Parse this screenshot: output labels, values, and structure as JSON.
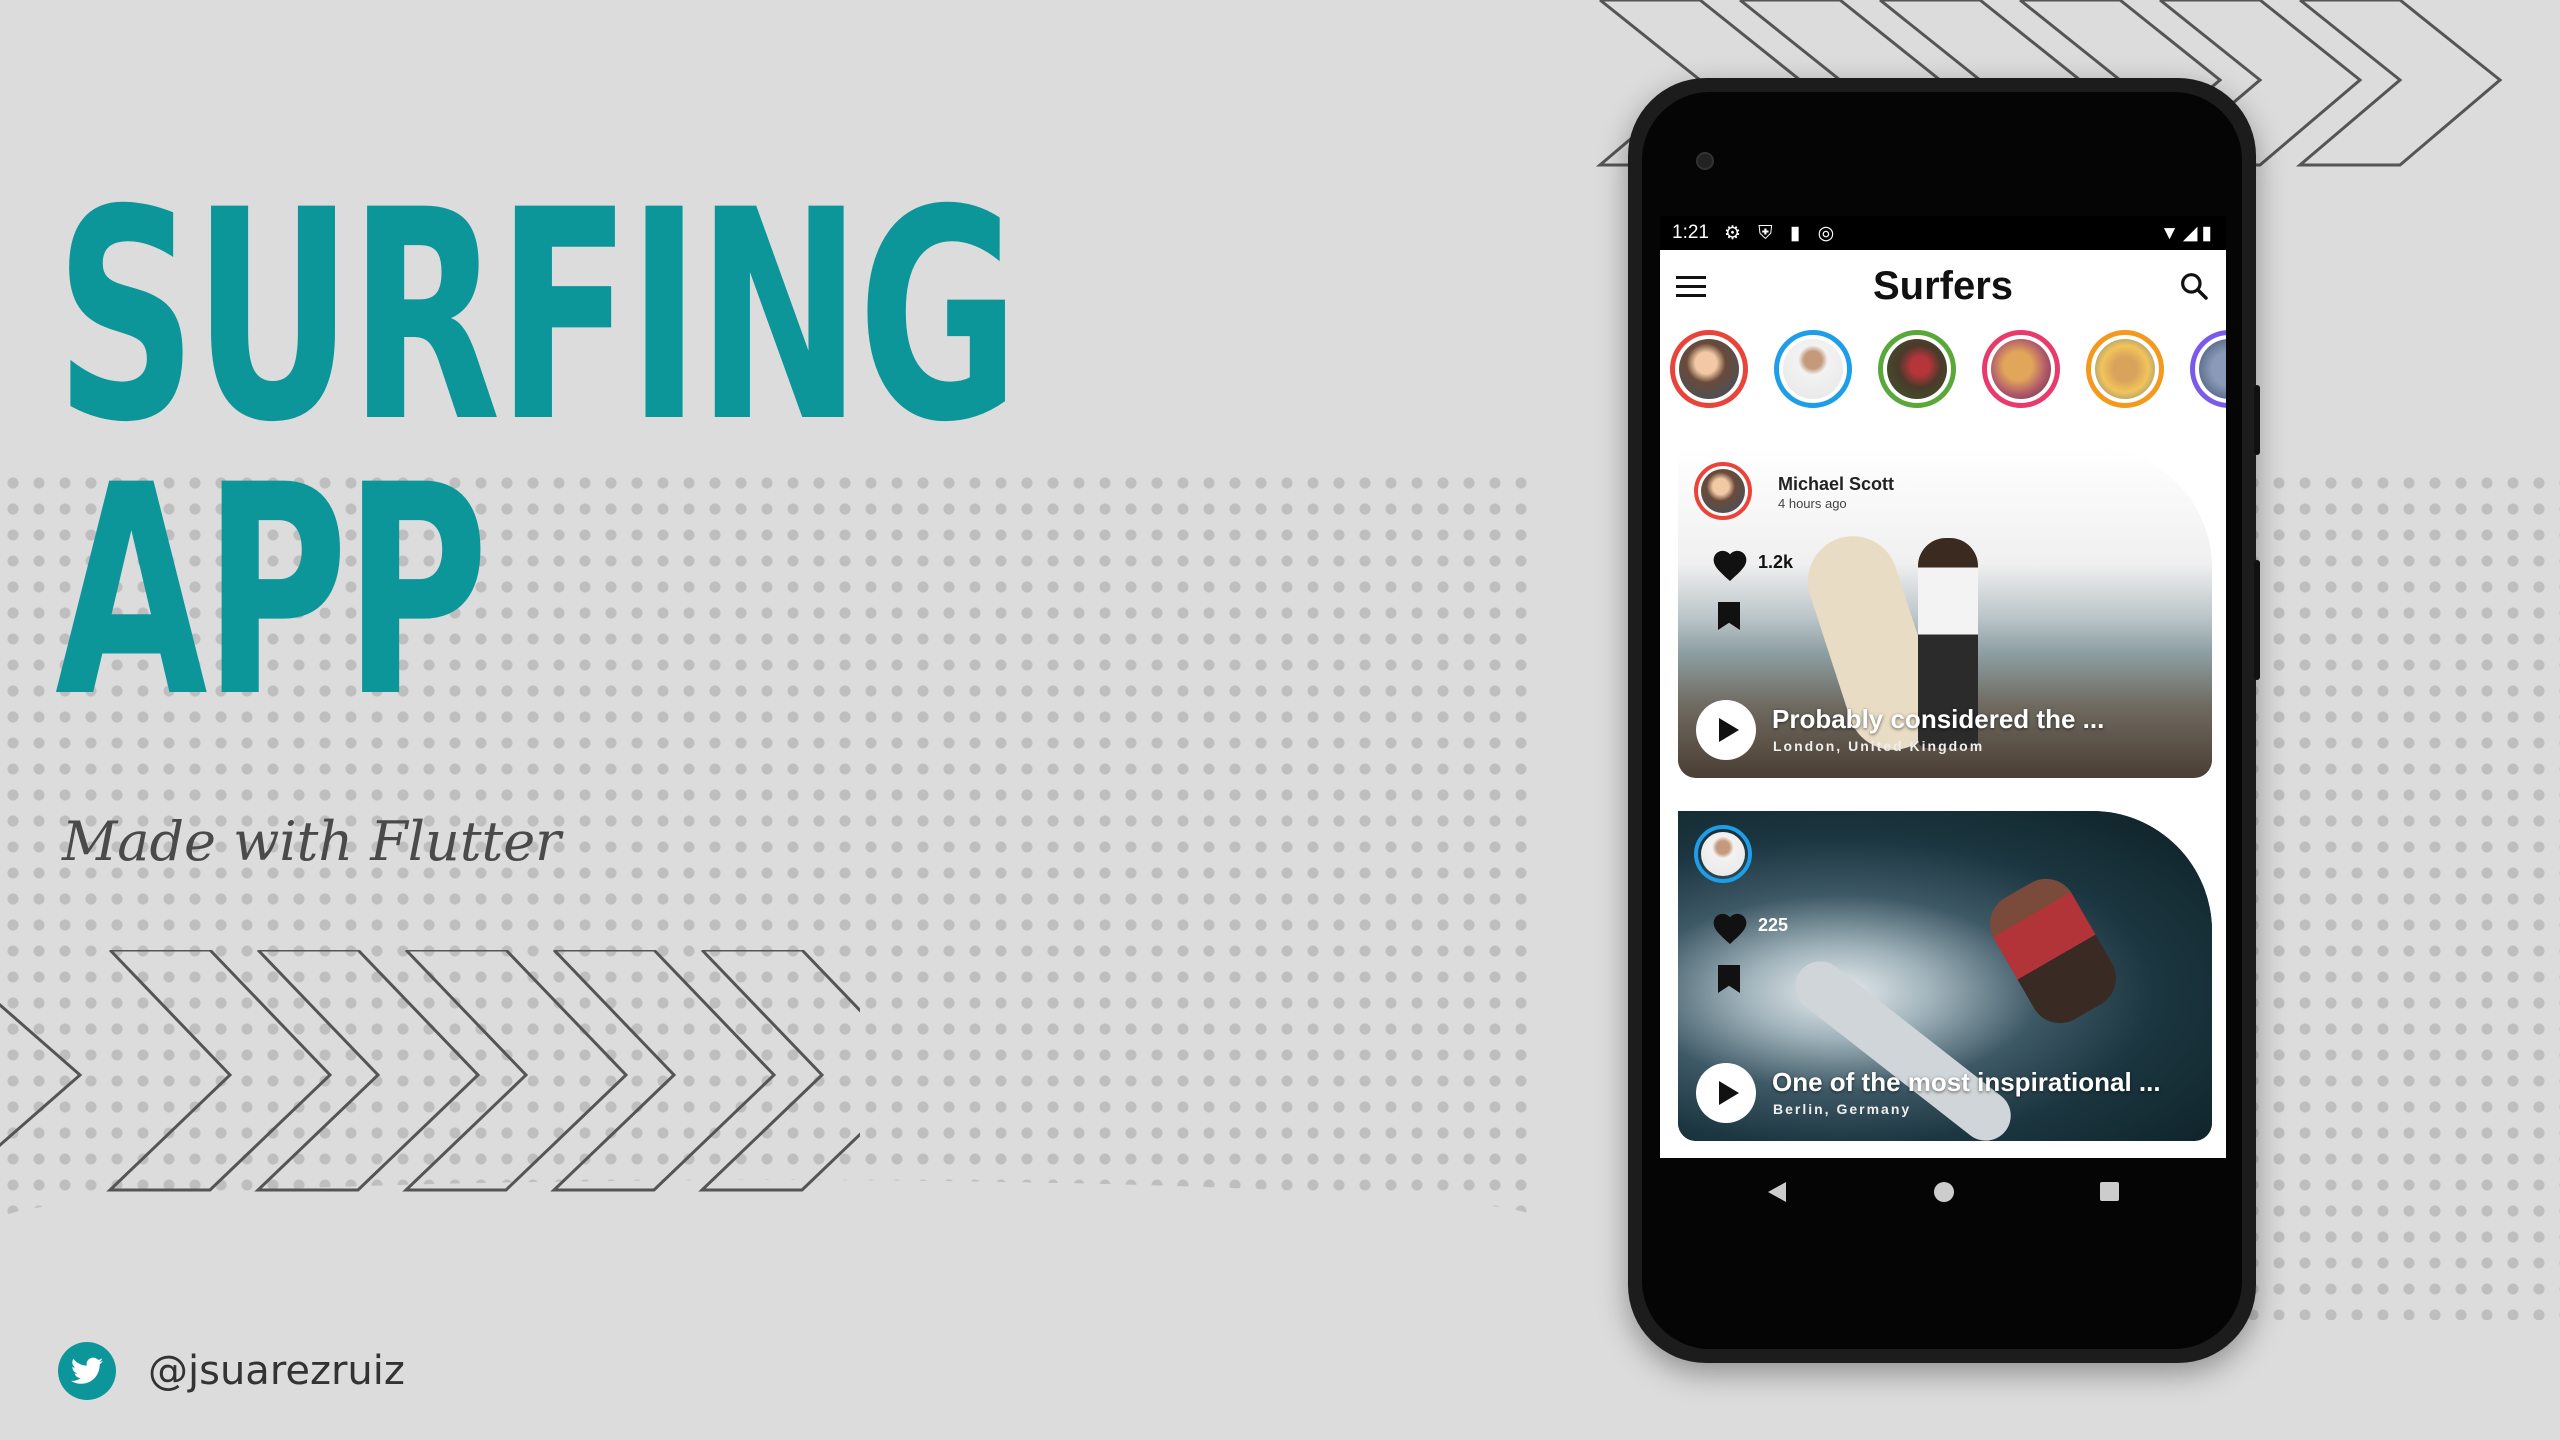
{
  "hero": {
    "line1": "SURFING",
    "line2": "APP",
    "tagline": "Made with Flutter",
    "handle": "@jsuarezruiz",
    "accent_color": "#0c969a"
  },
  "status_bar": {
    "time": "1:21",
    "left_icons": "⚙ ⛨ ▮ ◎",
    "right_icons": "▼◢▮"
  },
  "app": {
    "title": "Surfers"
  },
  "stories": [
    {
      "ring": "#e8443a",
      "icon": "avatar"
    },
    {
      "ring": "#1e9ee8",
      "icon": "avatar"
    },
    {
      "ring": "#5aa83a",
      "icon": "avatar"
    },
    {
      "ring": "#e83a6c",
      "icon": "avatar"
    },
    {
      "ring": "#f39a1e",
      "icon": "avatar"
    },
    {
      "ring": "#7a5ae8",
      "icon": "avatar"
    }
  ],
  "posts": [
    {
      "author": "Michael Scott",
      "time": "4 hours ago",
      "likes": "1.2k",
      "caption": "Probably considered the ...",
      "location": "London, United Kingdom",
      "ring": "#e8443a"
    },
    {
      "author": "",
      "time": "",
      "likes": "225",
      "caption": "One of the most inspirational ...",
      "location": "Berlin, Germany",
      "ring": "#1e9ee8"
    }
  ]
}
